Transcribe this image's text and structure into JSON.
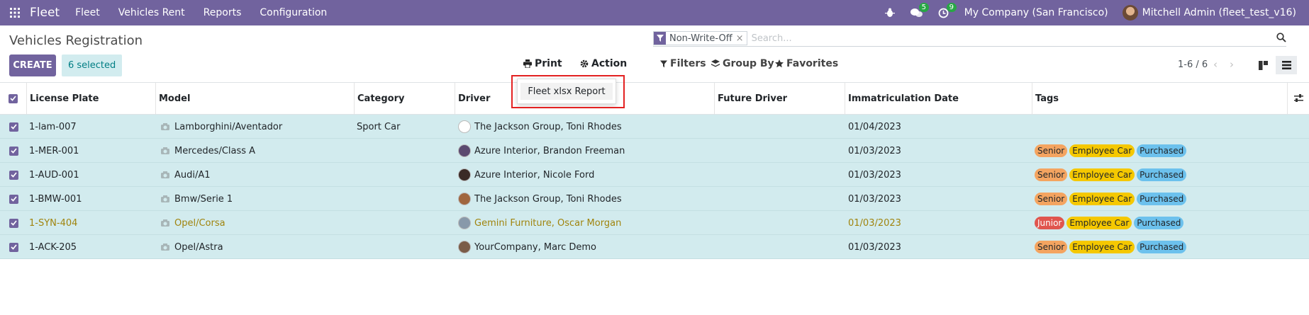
{
  "navbar": {
    "brand": "Fleet",
    "menus": [
      "Fleet",
      "Vehicles Rent",
      "Reports",
      "Configuration"
    ],
    "messages_count": "5",
    "activities_count": "9",
    "company": "My Company (San Francisco)",
    "user": "Mitchell Admin (fleet_test_v16)"
  },
  "page": {
    "title": "Vehicles Registration",
    "create_label": "CREATE",
    "selected_label": "6 selected",
    "print_label": "Print",
    "action_label": "Action",
    "filters_label": "Filters",
    "group_by_label": "Group By",
    "favorites_label": "Favorites",
    "pager": "1-6 / 6"
  },
  "search": {
    "facet": "Non-Write-Off",
    "placeholder": "Search..."
  },
  "print_dropdown": {
    "items": [
      "Fleet xlsx Report"
    ]
  },
  "table": {
    "headers": [
      "License Plate",
      "Model",
      "Category",
      "Driver",
      "Future Driver",
      "Immatriculation Date",
      "Tags"
    ],
    "rows": [
      {
        "plate": "1-lam-007",
        "model": "Lamborghini/Aventador",
        "category": "Sport Car",
        "driver": "The Jackson Group, Toni Rhodes",
        "date": "01/04/2023",
        "tags": []
      },
      {
        "plate": "1-MER-001",
        "model": "Mercedes/Class A",
        "category": "",
        "driver": "Azure Interior, Brandon Freeman",
        "date": "01/03/2023",
        "tags": [
          "Senior",
          "Employee Car",
          "Purchased"
        ]
      },
      {
        "plate": "1-AUD-001",
        "model": "Audi/A1",
        "category": "",
        "driver": "Azure Interior, Nicole Ford",
        "date": "01/03/2023",
        "tags": [
          "Senior",
          "Employee Car",
          "Purchased"
        ]
      },
      {
        "plate": "1-BMW-001",
        "model": "Bmw/Serie 1",
        "category": "",
        "driver": "The Jackson Group, Toni Rhodes",
        "date": "01/03/2023",
        "tags": [
          "Senior",
          "Employee Car",
          "Purchased"
        ]
      },
      {
        "plate": "1-SYN-404",
        "model": "Opel/Corsa",
        "category": "",
        "driver": "Gemini Furniture, Oscar Morgan",
        "date": "01/03/2023",
        "tags": [
          "Junior",
          "Employee Car",
          "Purchased"
        ]
      },
      {
        "plate": "1-ACK-205",
        "model": "Opel/Astra",
        "category": "",
        "driver": "YourCompany, Marc Demo",
        "date": "01/03/2023",
        "tags": [
          "Senior",
          "Employee Car",
          "Purchased"
        ]
      }
    ]
  },
  "colors": {
    "brand": "#71639e",
    "row_selected": "#d2ebee",
    "highlight": "#e32121",
    "tag_senior": "#f4a460",
    "tag_junior": "#e0554e",
    "tag_employee_car": "#f5c800",
    "tag_purchased": "#6cc1ed"
  }
}
